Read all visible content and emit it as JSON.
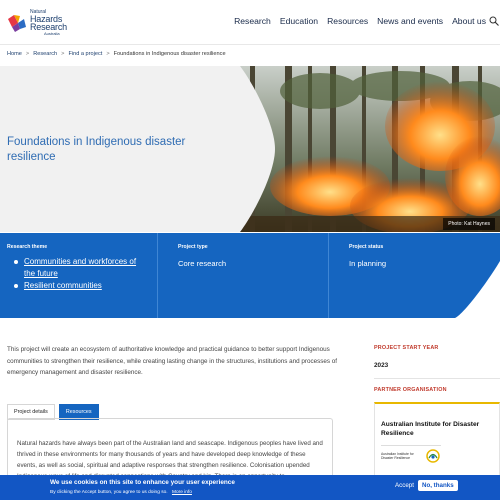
{
  "header": {
    "logo": {
      "line1": "Natural",
      "line2": "Hazards",
      "line3": "Research",
      "line4": "Australia"
    },
    "nav": [
      "Research",
      "Education",
      "Resources",
      "News and events",
      "About us"
    ]
  },
  "breadcrumb": [
    "Home",
    "Research",
    "Find a project",
    "Foundations in Indigenous disaster resilience"
  ],
  "breadcrumb_sep": ">",
  "hero": {
    "title": "Foundations in Indigenous disaster resilience",
    "photo_credit": "Photo: Kat Haynes"
  },
  "info": {
    "theme_heading": "Research theme",
    "themes": [
      "Communities and workforces of the future",
      "Resilient communities"
    ],
    "type_heading": "Project type",
    "type_value": "Core research",
    "status_heading": "Project status",
    "status_value": "In planning"
  },
  "intro": "This project will create an ecosystem of authoritative knowledge and practical guidance to better support Indigenous communities to strengthen their resilience, while creating lasting change in the structures, institutions and processes of emergency management and disaster resilience.",
  "sidebar": {
    "start_label": "PROJECT START YEAR",
    "start_value": "2023",
    "partner_label": "PARTNER ORGANISATION",
    "partner_name": "Australian Institute for Disaster Resilience",
    "partner_logo_line1": "Australian Institute for",
    "partner_logo_line2": "Disaster Resilience"
  },
  "tabs": [
    "Project details",
    "Resources"
  ],
  "tab_text": "Natural hazards have always been part of the Australian land and seascape. Indigenous peoples have lived and thrived in these environments for many thousands of years and have developed deep knowledge of these events, as well as social, spiritual and adaptive responses that strengthen resilience. Colonisation upended Indigenous ways of life and disrupted connections with Country and kin. There is an opportunity to",
  "cookie": {
    "title": "We use cookies on this site to enhance your user experience",
    "text": "By clicking the Accept button, you agree to us doing so.",
    "more": "More info",
    "accept": "Accept",
    "decline": "No, thanks"
  },
  "colors": {
    "brand_blue": "#1565c0",
    "hero_title": "#2f6cb3",
    "label_red": "#c0392b",
    "accent_yellow": "#e8b800"
  }
}
